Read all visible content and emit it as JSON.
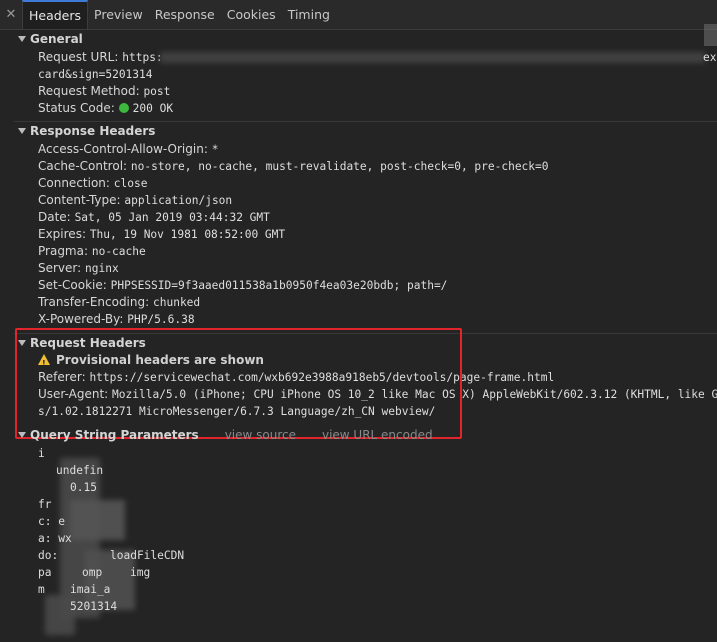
{
  "tabs": {
    "close": "✕",
    "items": [
      "Headers",
      "Preview",
      "Response",
      "Cookies",
      "Timing"
    ]
  },
  "general": {
    "title": "General",
    "request_url_key": "Request URL:",
    "request_url_val_start": "https:",
    "request_url_val_end": "card&sign=5201314",
    "request_url_tail": "ex",
    "request_method_key": "Request Method:",
    "request_method_val": "post",
    "status_code_key": "Status Code:",
    "status_code_val": "200 OK"
  },
  "response_headers": {
    "title": "Response Headers",
    "items": [
      {
        "key": "Access-Control-Allow-Origin:",
        "val": "*"
      },
      {
        "key": "Cache-Control:",
        "val": "no-store, no-cache, must-revalidate, post-check=0, pre-check=0"
      },
      {
        "key": "Connection:",
        "val": "close"
      },
      {
        "key": "Content-Type:",
        "val": "application/json"
      },
      {
        "key": "Date:",
        "val": "Sat, 05 Jan 2019 03:44:32 GMT"
      },
      {
        "key": "Expires:",
        "val": "Thu, 19 Nov 1981 08:52:00 GMT"
      },
      {
        "key": "Pragma:",
        "val": "no-cache"
      },
      {
        "key": "Server:",
        "val": "nginx"
      },
      {
        "key": "Set-Cookie:",
        "val": "PHPSESSID=9f3aaed011538a1b0950f4ea03e20bdb; path=/"
      },
      {
        "key": "Transfer-Encoding:",
        "val": "chunked"
      },
      {
        "key": "X-Powered-By:",
        "val": "PHP/5.6.38"
      }
    ]
  },
  "request_headers": {
    "title": "Request Headers",
    "warning": "Provisional headers are shown",
    "referer_key": "Referer:",
    "referer_val": "https://servicewechat.com/wxb692e3988a918eb5/devtools/page-frame.html",
    "ua_key": "User-Agent:",
    "ua_val_1": "Mozilla/5.0 (iPhone; CPU iPhone OS 10_2 like Mac OS X) AppleWebKit/602.3.12 (KHTML, like Gec",
    "ua_val_2": "s/1.02.1812271 MicroMessenger/6.7.3 Language/zh_CN webview/"
  },
  "query_string": {
    "title": "Query String Parameters",
    "view_source": "view source",
    "view_url_encoded": "view URL encoded",
    "fragments": [
      "i",
      "undefin",
      "0.15",
      "fr",
      "c: e",
      "a: wx",
      "do:",
      "loadFileCDN",
      "pa",
      "omp",
      "img",
      "m",
      "imai_a",
      "5201314"
    ]
  }
}
